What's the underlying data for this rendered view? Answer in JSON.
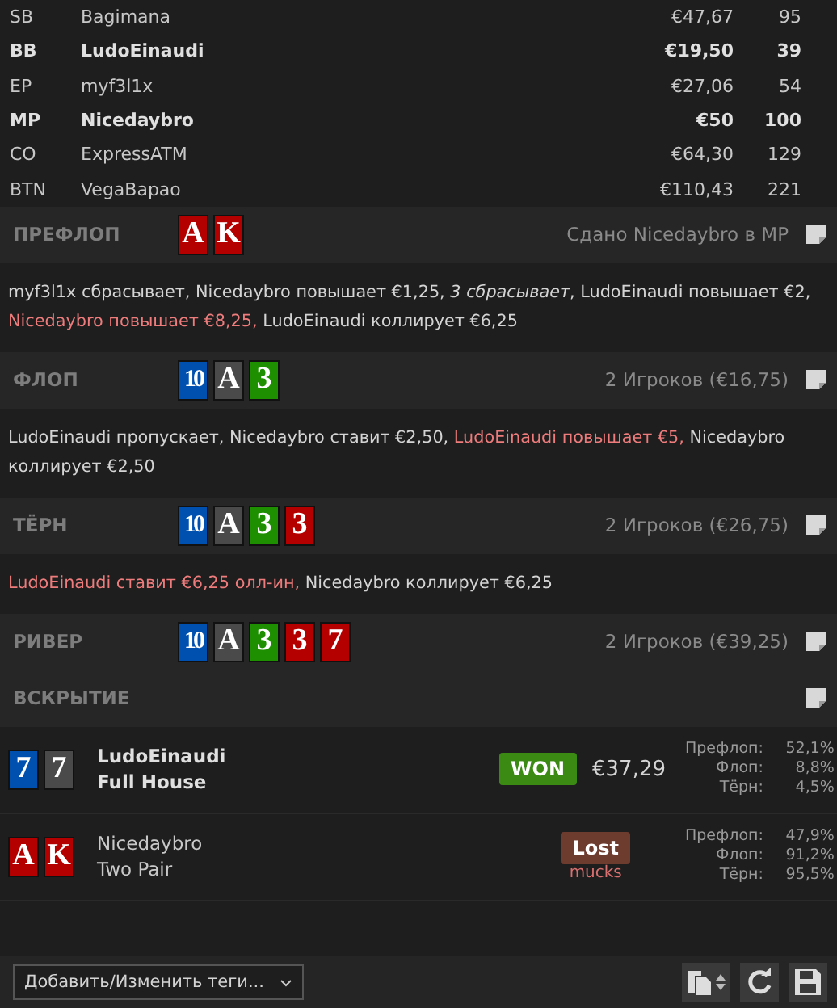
{
  "players": [
    {
      "position": "SB",
      "name": "Bagimana",
      "stack": "€47,67",
      "bb": "95",
      "highlighted": false
    },
    {
      "position": "BB",
      "name": "LudoEinaudi",
      "stack": "€19,50",
      "bb": "39",
      "highlighted": true
    },
    {
      "position": "EP",
      "name": "myf3l1x",
      "stack": "€27,06",
      "bb": "54",
      "highlighted": false
    },
    {
      "position": "MP",
      "name": "Nicedaybro",
      "stack": "€50",
      "bb": "100",
      "highlighted": true
    },
    {
      "position": "CO",
      "name": "ExpressATM",
      "stack": "€64,30",
      "bb": "129",
      "highlighted": false
    },
    {
      "position": "BTN",
      "name": "VegaBapao",
      "stack": "€110,43",
      "bb": "221",
      "highlighted": false
    }
  ],
  "streets": [
    {
      "label": "ПРЕФЛОП",
      "cards": [
        {
          "rank": "A",
          "color": "#b50000"
        },
        {
          "rank": "K",
          "color": "#b50000"
        }
      ],
      "summary": "Сдано Nicedaybro в MP",
      "actions": [
        {
          "text": "myf3l1x сбрасывает, Nicedaybro повышает €1,25, ",
          "kind": "plain"
        },
        {
          "text": "3 сбрасывает",
          "kind": "folds"
        },
        {
          "text": ", LudoEinaudi повышает €2, ",
          "kind": "plain"
        },
        {
          "text": "Nicedaybro повышает €8,25,",
          "kind": "aggressive"
        },
        {
          "text": " LudoEinaudi коллирует €6,25",
          "kind": "plain"
        }
      ]
    },
    {
      "label": "ФЛОП",
      "cards": [
        {
          "rank": "10",
          "color": "#0050b0"
        },
        {
          "rank": "A",
          "color": "#4a4a4a"
        },
        {
          "rank": "3",
          "color": "#1d8f00"
        }
      ],
      "summary": "2 Игроков (€16,75)",
      "actions": [
        {
          "text": "LudoEinaudi пропускает, Nicedaybro ставит €2,50, ",
          "kind": "plain"
        },
        {
          "text": "LudoEinaudi повышает €5,",
          "kind": "aggressive"
        },
        {
          "text": " Nicedaybro коллирует €2,50",
          "kind": "plain"
        }
      ]
    },
    {
      "label": "ТЁРН",
      "cards": [
        {
          "rank": "10",
          "color": "#0050b0"
        },
        {
          "rank": "A",
          "color": "#4a4a4a"
        },
        {
          "rank": "3",
          "color": "#1d8f00"
        },
        {
          "rank": "3",
          "color": "#b50000"
        }
      ],
      "summary": "2 Игроков (€26,75)",
      "actions": [
        {
          "text": "LudoEinaudi ставит €6,25 олл-ин,",
          "kind": "aggressive"
        },
        {
          "text": " Nicedaybro коллирует €6,25",
          "kind": "plain"
        }
      ]
    },
    {
      "label": "РИВЕР",
      "cards": [
        {
          "rank": "10",
          "color": "#0050b0"
        },
        {
          "rank": "A",
          "color": "#4a4a4a"
        },
        {
          "rank": "3",
          "color": "#1d8f00"
        },
        {
          "rank": "3",
          "color": "#b50000"
        },
        {
          "rank": "7",
          "color": "#b50000"
        }
      ],
      "summary": "2 Игроков (€39,25)"
    }
  ],
  "showdown": {
    "label": "ВСКРЫТИЕ",
    "players": [
      {
        "cards": [
          {
            "rank": "7",
            "color": "#0050b0"
          },
          {
            "rank": "7",
            "color": "#4a4a4a"
          }
        ],
        "name": "LudoEinaudi",
        "hand": "Full House",
        "winner": true,
        "result": "WON",
        "amount": "€37,29",
        "equity": [
          {
            "street": "Префлоп:",
            "value": "52,1%"
          },
          {
            "street": "Флоп:",
            "value": "8,8%"
          },
          {
            "street": "Тёрн:",
            "value": "4,5%"
          }
        ]
      },
      {
        "cards": [
          {
            "rank": "A",
            "color": "#b50000"
          },
          {
            "rank": "K",
            "color": "#b50000"
          }
        ],
        "name": "Nicedaybro",
        "hand": "Two Pair",
        "winner": false,
        "result": "Lost",
        "note": "mucks",
        "equity": [
          {
            "street": "Префлоп:",
            "value": "47,9%"
          },
          {
            "street": "Флоп:",
            "value": "91,2%"
          },
          {
            "street": "Тёрн:",
            "value": "95,5%"
          }
        ]
      }
    ]
  },
  "footer": {
    "tags_select": "Добавить/Изменить теги..."
  }
}
